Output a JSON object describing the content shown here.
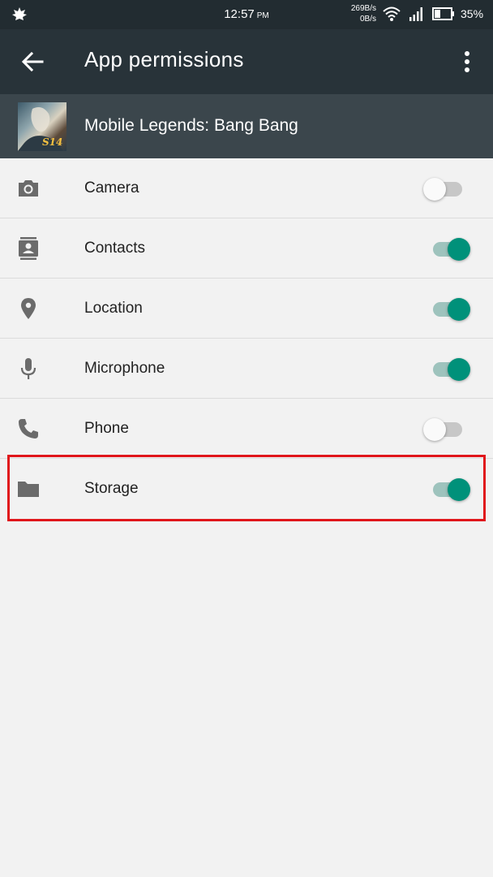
{
  "status_bar": {
    "time": "12:57",
    "ampm": "PM",
    "speed_up": "269B/s",
    "speed_down": "0B/s",
    "battery_percent": "35%"
  },
  "toolbar": {
    "title": "App permissions"
  },
  "app": {
    "name": "Mobile Legends: Bang Bang",
    "icon_badge": "S14"
  },
  "permissions": [
    {
      "label": "Camera",
      "icon": "camera-icon",
      "enabled": false
    },
    {
      "label": "Contacts",
      "icon": "contacts-icon",
      "enabled": true
    },
    {
      "label": "Location",
      "icon": "location-pin-icon",
      "enabled": true
    },
    {
      "label": "Microphone",
      "icon": "microphone-icon",
      "enabled": true
    },
    {
      "label": "Phone",
      "icon": "phone-icon",
      "enabled": false
    },
    {
      "label": "Storage",
      "icon": "folder-icon",
      "enabled": true
    }
  ],
  "colors": {
    "toolbar": "#283339",
    "accent": "#00917a",
    "highlight": "#e0161b"
  }
}
